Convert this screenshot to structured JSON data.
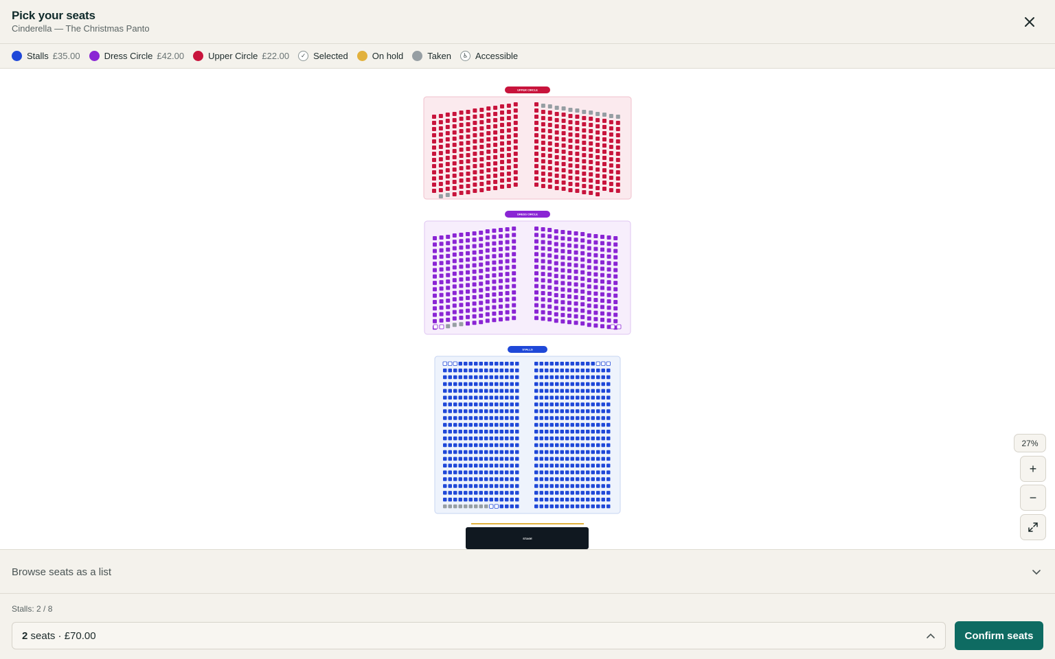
{
  "header": {
    "title": "Pick your seats",
    "subtitle": "Cinderella — The Christmas Panto",
    "close_icon": "close-icon"
  },
  "legend": {
    "items": [
      {
        "label": "Stalls",
        "price": "£35.00",
        "color": "#1f48d8"
      },
      {
        "label": "Dress Circle",
        "price": "£42.00",
        "color": "#8a25d4"
      },
      {
        "label": "Upper Circle",
        "price": "£22.00",
        "color": "#c8143c"
      },
      {
        "label": "Selected",
        "icon": "check-icon"
      },
      {
        "label": "On hold",
        "color": "#e2b13c"
      },
      {
        "label": "Taken",
        "color": "#969ea3"
      },
      {
        "label": "Accessible",
        "icon": "wheelchair-icon"
      }
    ]
  },
  "map": {
    "sections": {
      "upper": {
        "label": "UPPER CIRCLE",
        "color": "#c8143c",
        "bg": "#fbeaee",
        "border": "#f0c0cc"
      },
      "dress": {
        "label": "DRESS CIRCLE",
        "color": "#8a25d4",
        "bg": "#f7eefc",
        "border": "#dfc6f2"
      },
      "stalls": {
        "label": "STALLS",
        "color": "#1f48d8",
        "bg": "#eef3fc",
        "border": "#c7d4f2"
      }
    },
    "stage_label": "STAGE",
    "taken_color": "#969ea3",
    "hold_color": "#e2b13c"
  },
  "zoom": {
    "level": "27%",
    "zoom_in": "+",
    "zoom_out": "−"
  },
  "browse": {
    "label": "Browse seats as a list"
  },
  "footer": {
    "count": "Stalls: 2 / 8",
    "seats_count": "2",
    "seats_text": "seats · £70.00",
    "confirm_label": "Confirm seats"
  }
}
